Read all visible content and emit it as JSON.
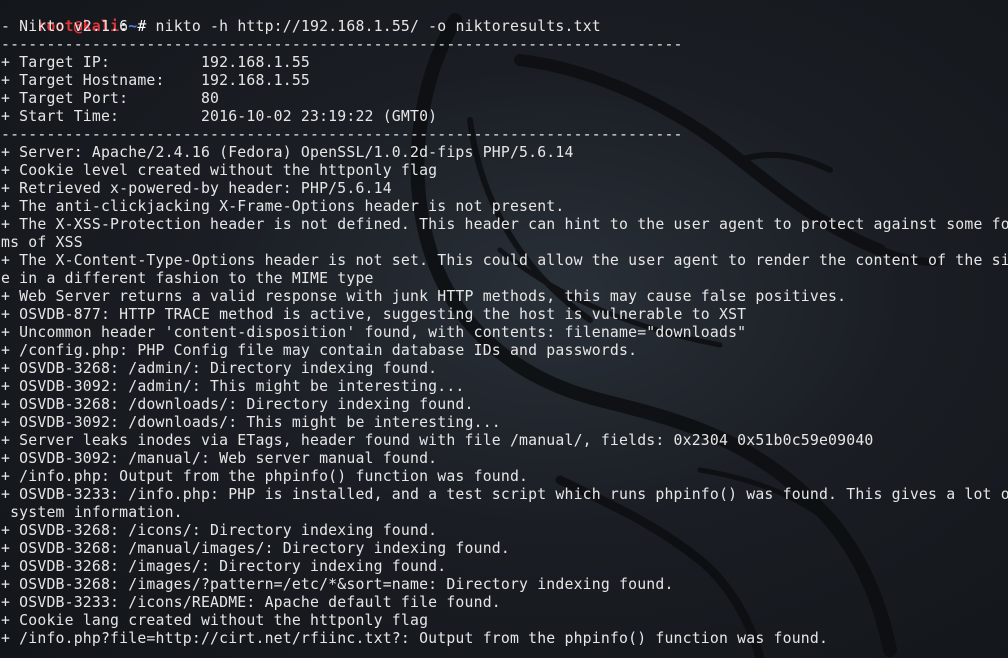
{
  "prompt": {
    "user_host": "root@kali",
    "separator": ":",
    "path": "~",
    "symbol": "# ",
    "command": "nikto -h http://192.168.1.55/ -o niktoresults.txt"
  },
  "output_lines": [
    "- Nikto v2.1.6",
    "---------------------------------------------------------------------------",
    "+ Target IP:          192.168.1.55",
    "+ Target Hostname:    192.168.1.55",
    "+ Target Port:        80",
    "+ Start Time:         2016-10-02 23:19:22 (GMT0)",
    "---------------------------------------------------------------------------",
    "+ Server: Apache/2.4.16 (Fedora) OpenSSL/1.0.2d-fips PHP/5.6.14",
    "+ Cookie level created without the httponly flag",
    "+ Retrieved x-powered-by header: PHP/5.6.14",
    "+ The anti-clickjacking X-Frame-Options header is not present.",
    "+ The X-XSS-Protection header is not defined. This header can hint to the user agent to protect against some for",
    "ms of XSS",
    "+ The X-Content-Type-Options header is not set. This could allow the user agent to render the content of the sit",
    "e in a different fashion to the MIME type",
    "+ Web Server returns a valid response with junk HTTP methods, this may cause false positives.",
    "+ OSVDB-877: HTTP TRACE method is active, suggesting the host is vulnerable to XST",
    "+ Uncommon header 'content-disposition' found, with contents: filename=\"downloads\"",
    "+ /config.php: PHP Config file may contain database IDs and passwords.",
    "+ OSVDB-3268: /admin/: Directory indexing found.",
    "+ OSVDB-3092: /admin/: This might be interesting...",
    "+ OSVDB-3268: /downloads/: Directory indexing found.",
    "+ OSVDB-3092: /downloads/: This might be interesting...",
    "+ Server leaks inodes via ETags, header found with file /manual/, fields: 0x2304 0x51b0c59e09040",
    "+ OSVDB-3092: /manual/: Web server manual found.",
    "+ /info.php: Output from the phpinfo() function was found.",
    "+ OSVDB-3233: /info.php: PHP is installed, and a test script which runs phpinfo() was found. This gives a lot of",
    " system information.",
    "+ OSVDB-3268: /icons/: Directory indexing found.",
    "+ OSVDB-3268: /manual/images/: Directory indexing found.",
    "+ OSVDB-3268: /images/: Directory indexing found.",
    "+ OSVDB-3268: /images/?pattern=/etc/*&sort=name: Directory indexing found.",
    "+ OSVDB-3233: /icons/README: Apache default file found.",
    "+ Cookie lang created without the httponly flag",
    "+ /info.php?file=http://cirt.net/rfiinc.txt?: Output from the phpinfo() function was found."
  ],
  "colors": {
    "background": "#1a1e24",
    "text": "#e6e6e6",
    "prompt_user": "#e3343a",
    "prompt_path": "#4f7fe0",
    "watermark": "#0c0e11"
  },
  "watermark_icon": "kali-dragon-icon"
}
